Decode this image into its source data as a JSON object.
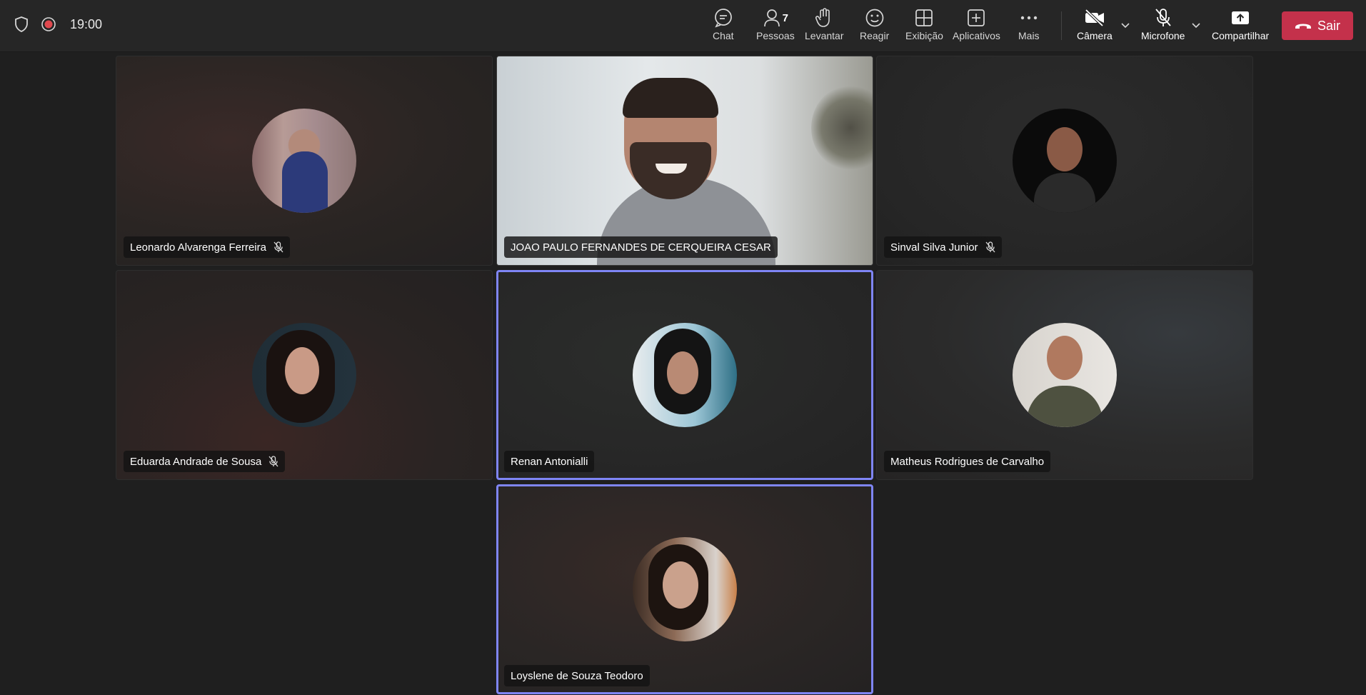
{
  "meeting": {
    "timer": "19:00"
  },
  "toolbar": {
    "chat": "Chat",
    "people": "Pessoas",
    "people_count": "7",
    "raise": "Levantar",
    "react": "Reagir",
    "view": "Exibição",
    "apps": "Aplicativos",
    "more": "Mais",
    "camera": "Câmera",
    "mic": "Microfone",
    "share": "Compartilhar",
    "leave": "Sair"
  },
  "colors": {
    "leave_button": "#c4314b",
    "active_speaker_border": "#7f85f5",
    "recording_dot": "#e0484e"
  },
  "participants": [
    {
      "name": "Leonardo Alvarenga Ferreira",
      "muted": true,
      "speaking": false,
      "video": false
    },
    {
      "name": "JOAO PAULO FERNANDES DE CERQUEIRA CESAR",
      "muted": false,
      "speaking": false,
      "video": true
    },
    {
      "name": "Sinval Silva Junior",
      "muted": true,
      "speaking": false,
      "video": false
    },
    {
      "name": "Eduarda Andrade de Sousa",
      "muted": true,
      "speaking": false,
      "video": false
    },
    {
      "name": "Renan Antonialli",
      "muted": false,
      "speaking": true,
      "video": false
    },
    {
      "name": "Matheus Rodrigues de Carvalho",
      "muted": false,
      "speaking": false,
      "video": false
    },
    {
      "name": "Loyslene de Souza Teodoro",
      "muted": false,
      "speaking": true,
      "video": false
    }
  ]
}
